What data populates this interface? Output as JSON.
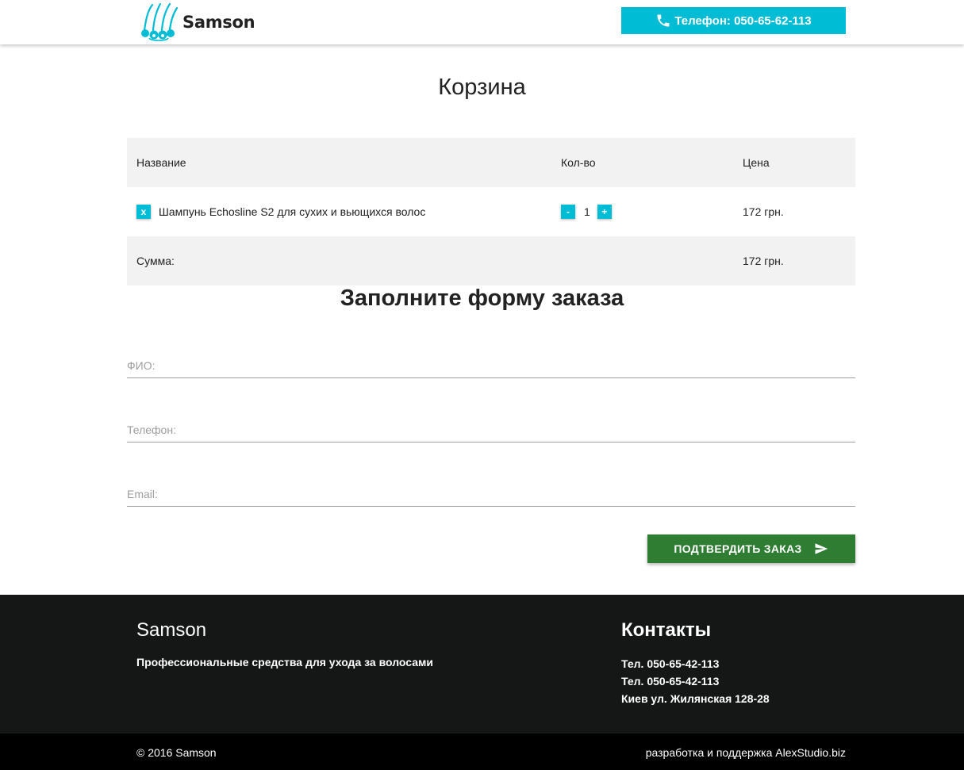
{
  "header": {
    "brand": "Samson",
    "phone_label": "Телефон: 050-65-62-113"
  },
  "cart": {
    "title": "Корзина",
    "columns": [
      "Название",
      "Кол-во",
      "Цена"
    ],
    "items": [
      {
        "remove_label": "x",
        "name": "Шампунь Echosline S2 для сухих и вьющихся волос",
        "qty": "1",
        "price": "172 грн."
      }
    ],
    "qty_minus": "-",
    "qty_plus": "+",
    "total_label": "Сумма:",
    "total_value": "172 грн."
  },
  "order_form": {
    "title": "Заполните форму заказа",
    "fields": [
      {
        "placeholder": "ФИО:"
      },
      {
        "placeholder": "Телефон:"
      },
      {
        "placeholder": "Email:"
      }
    ],
    "submit_label": "Подтвердить заказ"
  },
  "footer": {
    "brand": "Samson",
    "description": "Профессиональные средства для ухода за волосами",
    "contacts_title": "Контакты",
    "contacts": [
      "Тел. 050-65-42-113",
      "Тел. 050-65-42-113",
      "Киев ул. Жилянская 128-28"
    ],
    "copyright": "© 2016 Samson",
    "credits": "разработка и поддержка AlexStudio.biz"
  },
  "colors": {
    "accent": "#00bcd4",
    "submit": "#2e7d32",
    "footer_bg": "#151616",
    "subfooter_bg": "#000000"
  },
  "icons": [
    "logo-hair-follicle-icon",
    "phone-icon",
    "send-icon"
  ]
}
